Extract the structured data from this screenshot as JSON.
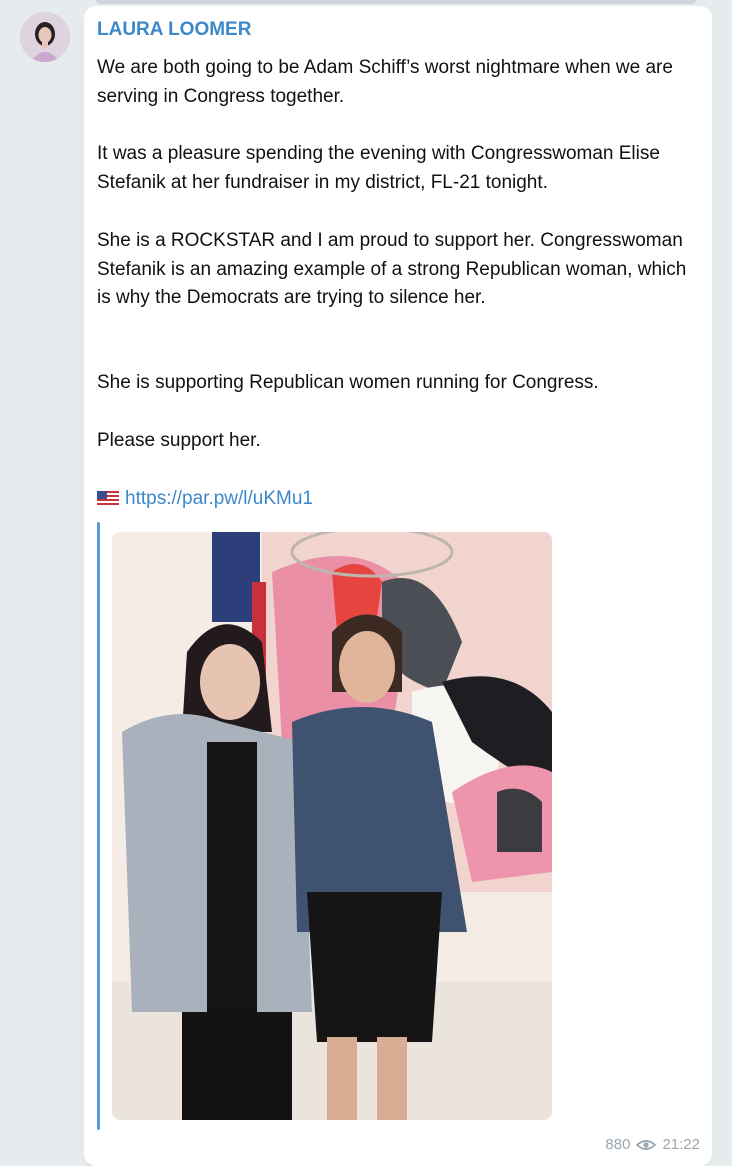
{
  "post": {
    "author": "LAURA LOOMER",
    "paragraphs": [
      "We are both going to be Adam Schiff’s worst nightmare when we are serving in Congress together.",
      "It was a pleasure spending the evening with Congresswoman Elise Stefanik at her fundraiser in my district, FL-21 tonight.",
      "She is a ROCKSTAR and I am proud to support her. Congresswoman Stefanik is an amazing example of a strong Republican woman, which is why the Democrats are trying to silence her.",
      "She is supporting Republican women running for Congress.",
      "Please support her."
    ],
    "link_icon": "us-flag-icon",
    "link": "https://par.pw/l/uKMu1",
    "views": "880",
    "time": "21:22"
  },
  "colors": {
    "author": "#3d88c9",
    "link": "#3d88c9",
    "quote_bar": "#5a9bd5",
    "background": "#e6ebee",
    "meta": "#9aa6ae"
  }
}
